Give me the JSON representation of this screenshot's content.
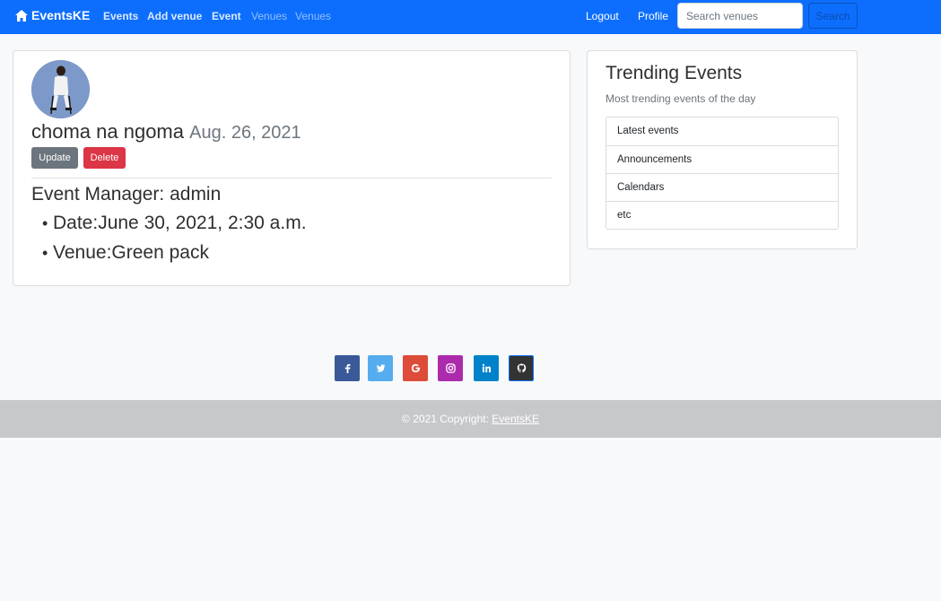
{
  "navbar": {
    "brand": "EventsKE",
    "links": [
      "Events",
      "Add venue",
      "Event",
      "Venues",
      "Venues"
    ],
    "logout": "Logout",
    "profile": "Profile",
    "search_placeholder": "Search venues",
    "search_button": "Search"
  },
  "event": {
    "title": "choma na ngoma",
    "posted_date": "Aug. 26, 2021",
    "update_label": "Update",
    "delete_label": "Delete",
    "manager": "Event Manager: admin",
    "date": "Date:June 30, 2021, 2:30 a.m.",
    "venue": "Venue:Green pack"
  },
  "sidebar": {
    "title": "Trending Events",
    "subtitle": "Most trending events of the day",
    "items": [
      "Latest events",
      "Announcements",
      "Calendars",
      "etc"
    ]
  },
  "footer": {
    "social": [
      {
        "icon": "facebook-icon",
        "color": "#3b5998"
      },
      {
        "icon": "twitter-icon",
        "color": "#55acee"
      },
      {
        "icon": "google-icon",
        "color": "#dd4b39"
      },
      {
        "icon": "instagram-icon",
        "color": "#ac2bac"
      },
      {
        "icon": "linkedin-icon",
        "color": "#0082ca"
      },
      {
        "icon": "github-icon",
        "color": "#333333"
      }
    ],
    "copyright_prefix": "© 2021 Copyright: ",
    "copyright_link": "EventsKE"
  },
  "colors": {
    "navbar": "#0d6efd",
    "update_button": "#6c757d",
    "delete_button": "#dc3545",
    "footer_bar": "#c7c8ca"
  }
}
